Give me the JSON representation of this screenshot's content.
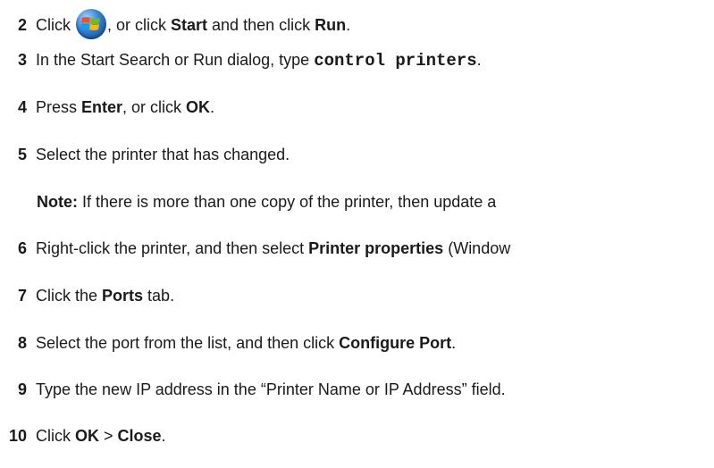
{
  "steps": [
    {
      "num": "2",
      "parts": {
        "a": "Click ",
        "b": ", or click ",
        "start": "Start",
        "c": " and then click ",
        "run": "Run",
        "d": "."
      }
    },
    {
      "num": "3",
      "parts": {
        "a": "In the Start Search or Run dialog, type ",
        "code": "control printers",
        "b": "."
      }
    },
    {
      "num": "4",
      "parts": {
        "a": "Press ",
        "enter": "Enter",
        "b": ", or click ",
        "ok": "OK",
        "c": "."
      }
    },
    {
      "num": "5",
      "text": "Select the printer that has changed."
    },
    {
      "num": "6",
      "parts": {
        "a": "Right-click the printer, and then select ",
        "pp": "Printer properties",
        "b": " (Window"
      }
    },
    {
      "num": "7",
      "parts": {
        "a": "Click the ",
        "ports": "Ports",
        "b": " tab."
      }
    },
    {
      "num": "8",
      "parts": {
        "a": "Select the port from the list, and then click ",
        "cp": "Configure Port",
        "b": "."
      }
    },
    {
      "num": "9",
      "text": "Type the new IP address in the “Printer Name or IP Address” field."
    },
    {
      "num": "10",
      "parts": {
        "a": "Click ",
        "ok": "OK",
        "gt": " > ",
        "close": "Close",
        "b": "."
      }
    }
  ],
  "note": {
    "label": "Note:",
    "text": " If there is more than one copy of the printer, then update a"
  },
  "icons": {
    "start_orb": "windows-start-orb-icon"
  }
}
